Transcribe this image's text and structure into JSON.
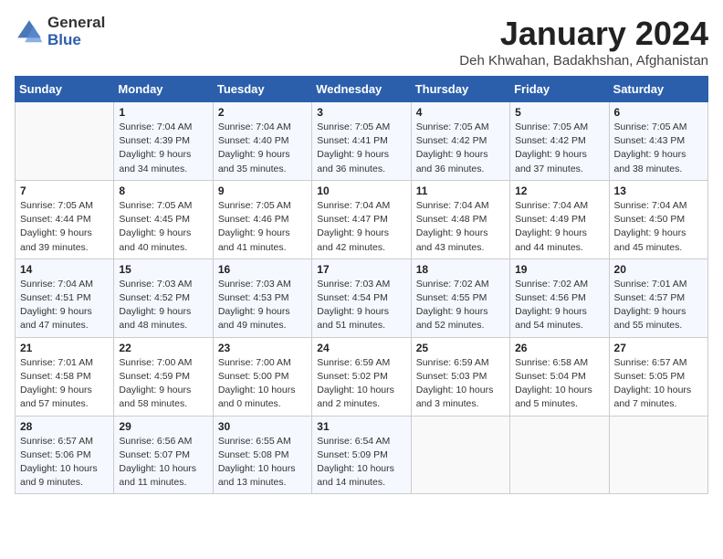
{
  "logo": {
    "general": "General",
    "blue": "Blue"
  },
  "title": "January 2024",
  "location": "Deh Khwahan, Badakhshan, Afghanistan",
  "days_of_week": [
    "Sunday",
    "Monday",
    "Tuesday",
    "Wednesday",
    "Thursday",
    "Friday",
    "Saturday"
  ],
  "weeks": [
    [
      {
        "day": "",
        "sunrise": "",
        "sunset": "",
        "daylight": ""
      },
      {
        "day": "1",
        "sunrise": "Sunrise: 7:04 AM",
        "sunset": "Sunset: 4:39 PM",
        "daylight": "Daylight: 9 hours and 34 minutes."
      },
      {
        "day": "2",
        "sunrise": "Sunrise: 7:04 AM",
        "sunset": "Sunset: 4:40 PM",
        "daylight": "Daylight: 9 hours and 35 minutes."
      },
      {
        "day": "3",
        "sunrise": "Sunrise: 7:05 AM",
        "sunset": "Sunset: 4:41 PM",
        "daylight": "Daylight: 9 hours and 36 minutes."
      },
      {
        "day": "4",
        "sunrise": "Sunrise: 7:05 AM",
        "sunset": "Sunset: 4:42 PM",
        "daylight": "Daylight: 9 hours and 36 minutes."
      },
      {
        "day": "5",
        "sunrise": "Sunrise: 7:05 AM",
        "sunset": "Sunset: 4:42 PM",
        "daylight": "Daylight: 9 hours and 37 minutes."
      },
      {
        "day": "6",
        "sunrise": "Sunrise: 7:05 AM",
        "sunset": "Sunset: 4:43 PM",
        "daylight": "Daylight: 9 hours and 38 minutes."
      }
    ],
    [
      {
        "day": "7",
        "sunrise": "Sunrise: 7:05 AM",
        "sunset": "Sunset: 4:44 PM",
        "daylight": "Daylight: 9 hours and 39 minutes."
      },
      {
        "day": "8",
        "sunrise": "Sunrise: 7:05 AM",
        "sunset": "Sunset: 4:45 PM",
        "daylight": "Daylight: 9 hours and 40 minutes."
      },
      {
        "day": "9",
        "sunrise": "Sunrise: 7:05 AM",
        "sunset": "Sunset: 4:46 PM",
        "daylight": "Daylight: 9 hours and 41 minutes."
      },
      {
        "day": "10",
        "sunrise": "Sunrise: 7:04 AM",
        "sunset": "Sunset: 4:47 PM",
        "daylight": "Daylight: 9 hours and 42 minutes."
      },
      {
        "day": "11",
        "sunrise": "Sunrise: 7:04 AM",
        "sunset": "Sunset: 4:48 PM",
        "daylight": "Daylight: 9 hours and 43 minutes."
      },
      {
        "day": "12",
        "sunrise": "Sunrise: 7:04 AM",
        "sunset": "Sunset: 4:49 PM",
        "daylight": "Daylight: 9 hours and 44 minutes."
      },
      {
        "day": "13",
        "sunrise": "Sunrise: 7:04 AM",
        "sunset": "Sunset: 4:50 PM",
        "daylight": "Daylight: 9 hours and 45 minutes."
      }
    ],
    [
      {
        "day": "14",
        "sunrise": "Sunrise: 7:04 AM",
        "sunset": "Sunset: 4:51 PM",
        "daylight": "Daylight: 9 hours and 47 minutes."
      },
      {
        "day": "15",
        "sunrise": "Sunrise: 7:03 AM",
        "sunset": "Sunset: 4:52 PM",
        "daylight": "Daylight: 9 hours and 48 minutes."
      },
      {
        "day": "16",
        "sunrise": "Sunrise: 7:03 AM",
        "sunset": "Sunset: 4:53 PM",
        "daylight": "Daylight: 9 hours and 49 minutes."
      },
      {
        "day": "17",
        "sunrise": "Sunrise: 7:03 AM",
        "sunset": "Sunset: 4:54 PM",
        "daylight": "Daylight: 9 hours and 51 minutes."
      },
      {
        "day": "18",
        "sunrise": "Sunrise: 7:02 AM",
        "sunset": "Sunset: 4:55 PM",
        "daylight": "Daylight: 9 hours and 52 minutes."
      },
      {
        "day": "19",
        "sunrise": "Sunrise: 7:02 AM",
        "sunset": "Sunset: 4:56 PM",
        "daylight": "Daylight: 9 hours and 54 minutes."
      },
      {
        "day": "20",
        "sunrise": "Sunrise: 7:01 AM",
        "sunset": "Sunset: 4:57 PM",
        "daylight": "Daylight: 9 hours and 55 minutes."
      }
    ],
    [
      {
        "day": "21",
        "sunrise": "Sunrise: 7:01 AM",
        "sunset": "Sunset: 4:58 PM",
        "daylight": "Daylight: 9 hours and 57 minutes."
      },
      {
        "day": "22",
        "sunrise": "Sunrise: 7:00 AM",
        "sunset": "Sunset: 4:59 PM",
        "daylight": "Daylight: 9 hours and 58 minutes."
      },
      {
        "day": "23",
        "sunrise": "Sunrise: 7:00 AM",
        "sunset": "Sunset: 5:00 PM",
        "daylight": "Daylight: 10 hours and 0 minutes."
      },
      {
        "day": "24",
        "sunrise": "Sunrise: 6:59 AM",
        "sunset": "Sunset: 5:02 PM",
        "daylight": "Daylight: 10 hours and 2 minutes."
      },
      {
        "day": "25",
        "sunrise": "Sunrise: 6:59 AM",
        "sunset": "Sunset: 5:03 PM",
        "daylight": "Daylight: 10 hours and 3 minutes."
      },
      {
        "day": "26",
        "sunrise": "Sunrise: 6:58 AM",
        "sunset": "Sunset: 5:04 PM",
        "daylight": "Daylight: 10 hours and 5 minutes."
      },
      {
        "day": "27",
        "sunrise": "Sunrise: 6:57 AM",
        "sunset": "Sunset: 5:05 PM",
        "daylight": "Daylight: 10 hours and 7 minutes."
      }
    ],
    [
      {
        "day": "28",
        "sunrise": "Sunrise: 6:57 AM",
        "sunset": "Sunset: 5:06 PM",
        "daylight": "Daylight: 10 hours and 9 minutes."
      },
      {
        "day": "29",
        "sunrise": "Sunrise: 6:56 AM",
        "sunset": "Sunset: 5:07 PM",
        "daylight": "Daylight: 10 hours and 11 minutes."
      },
      {
        "day": "30",
        "sunrise": "Sunrise: 6:55 AM",
        "sunset": "Sunset: 5:08 PM",
        "daylight": "Daylight: 10 hours and 13 minutes."
      },
      {
        "day": "31",
        "sunrise": "Sunrise: 6:54 AM",
        "sunset": "Sunset: 5:09 PM",
        "daylight": "Daylight: 10 hours and 14 minutes."
      },
      {
        "day": "",
        "sunrise": "",
        "sunset": "",
        "daylight": ""
      },
      {
        "day": "",
        "sunrise": "",
        "sunset": "",
        "daylight": ""
      },
      {
        "day": "",
        "sunrise": "",
        "sunset": "",
        "daylight": ""
      }
    ]
  ]
}
